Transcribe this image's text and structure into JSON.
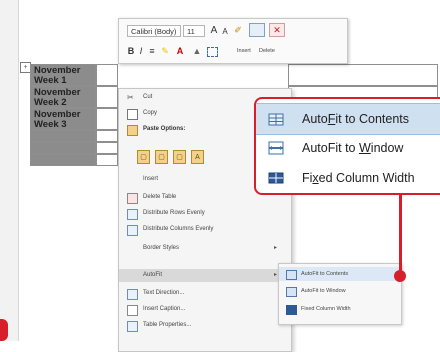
{
  "table": {
    "rows": [
      {
        "label": "November Week 1"
      },
      {
        "label": "November Week 2"
      },
      {
        "label": "November Week 3"
      }
    ]
  },
  "toolbar": {
    "font_name": "Calibri (Body)",
    "font_size": "11",
    "grow_font": "A",
    "shrink_font": "A",
    "bold": "B",
    "italic": "I",
    "align": "≡",
    "font_color": "A",
    "insert_label": "Insert",
    "delete_label": "Delete"
  },
  "context_menu": {
    "items": [
      {
        "label": "Cut"
      },
      {
        "label": "Copy"
      },
      {
        "label": "Paste Options:"
      },
      {
        "label": "Insert"
      },
      {
        "label": "Delete Table"
      },
      {
        "label": "Distribute Rows Evenly"
      },
      {
        "label": "Distribute Columns Evenly"
      },
      {
        "label": "Border Styles"
      },
      {
        "label": "AutoFit"
      },
      {
        "label": "Text Direction..."
      },
      {
        "label": "Insert Caption..."
      },
      {
        "label": "Table Properties..."
      }
    ]
  },
  "autofit_submenu": {
    "items": [
      {
        "label": "AutoFit to Contents"
      },
      {
        "label": "AutoFit to Window"
      },
      {
        "label": "Fixed Column Width"
      }
    ]
  },
  "callout": {
    "items": [
      {
        "pre": "Auto",
        "key": "F",
        "post": "it to Contents"
      },
      {
        "pre": "AutoFit to ",
        "key": "W",
        "post": "indow"
      },
      {
        "pre": "Fi",
        "key": "x",
        "post": "ed Column Width"
      }
    ]
  },
  "colors": {
    "accent": "#d71f2b",
    "highlight": "#cfe0f1",
    "table_header": "#8c8c8c"
  }
}
